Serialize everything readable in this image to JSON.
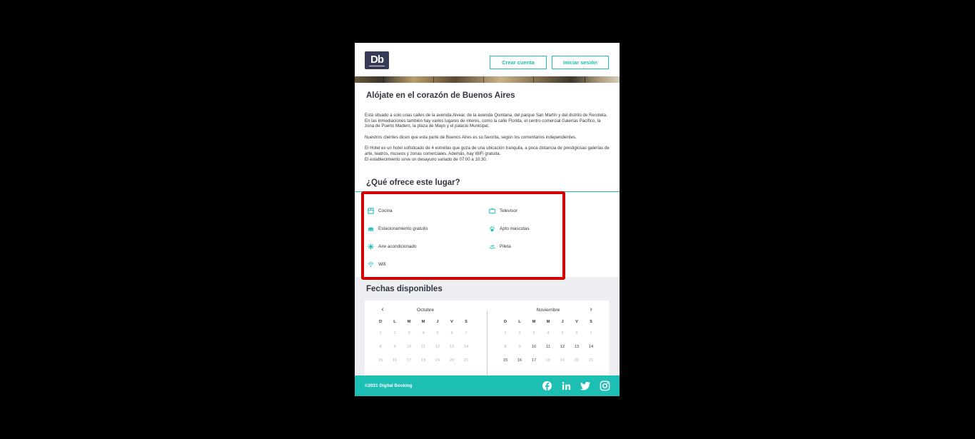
{
  "header": {
    "logo_text": "Db",
    "create_account_label": "Crear cuenta",
    "login_label": "Iniciar sesión"
  },
  "product": {
    "title": "Alójate en el corazón de Buenos Aires",
    "description": [
      "Está situado a solo unas calles de la avenida Alvear, de la avenida Quintana, del parque San Martín y del distrito de Recoleta. En las inmediaciones también hay varios lugares de interés, como la calle Florida, el centro comercial Galerías Pacífico, la zona de Puerto Madero, la plaza de Mayo y el palacio Municipal.",
      "Nuestros clientes dicen que esta parte de Buenos Aires es su favorita, según los comentarios independientes.",
      "El Hotel es un hotel sofisticado de 4 estrellas que goza de una ubicación tranquila, a poca distancia de prestigiosas galerías de arte, teatros, museos y zonas comerciales. Además, hay WiFi gratuita.\nEl establecimiento sirve un desayuno variado de 07:00 a 10:30."
    ]
  },
  "features": {
    "title": "¿Qué ofrece este lugar?",
    "items": [
      {
        "label": "Cocina",
        "icon": "kitchen-icon"
      },
      {
        "label": "Televisor",
        "icon": "tv-icon"
      },
      {
        "label": "Estacionamiento gratuito",
        "icon": "car-icon"
      },
      {
        "label": "Apto mascotas",
        "icon": "paw-icon"
      },
      {
        "label": "Aire acondicionado",
        "icon": "snowflake-icon"
      },
      {
        "label": "Pileta",
        "icon": "swimmer-icon"
      },
      {
        "label": "Wifi",
        "icon": "wifi-icon"
      }
    ]
  },
  "dates": {
    "title": "Fechas disponibles",
    "weekdays": [
      "D",
      "L",
      "M",
      "M",
      "J",
      "V",
      "S"
    ],
    "months": [
      {
        "name": "Octubre",
        "weeks": [
          [
            "1",
            "2",
            "3",
            "4",
            "5",
            "6",
            "7"
          ],
          [
            "8",
            "9",
            "10",
            "11",
            "12",
            "13",
            "14"
          ],
          [
            "15",
            "16",
            "17",
            "18",
            "19",
            "20",
            "21"
          ]
        ],
        "active_from": 99
      },
      {
        "name": "Noviembre",
        "weeks": [
          [
            "1",
            "2",
            "3",
            "4",
            "5",
            "6",
            "7"
          ],
          [
            "8",
            "9",
            "10",
            "11",
            "12",
            "13",
            "14"
          ],
          [
            "15",
            "16",
            "17",
            "18",
            "19",
            "20",
            "21"
          ]
        ],
        "active_days": [
          "10",
          "11",
          "12",
          "13",
          "14",
          "15",
          "16",
          "17"
        ]
      }
    ]
  },
  "footer": {
    "copyright": "©2021 Digital Booking",
    "social": [
      "facebook-icon",
      "linkedin-icon",
      "twitter-icon",
      "instagram-icon"
    ]
  },
  "colors": {
    "accent": "#1dbeb4",
    "dark": "#383b58",
    "highlight": "#d10000"
  }
}
